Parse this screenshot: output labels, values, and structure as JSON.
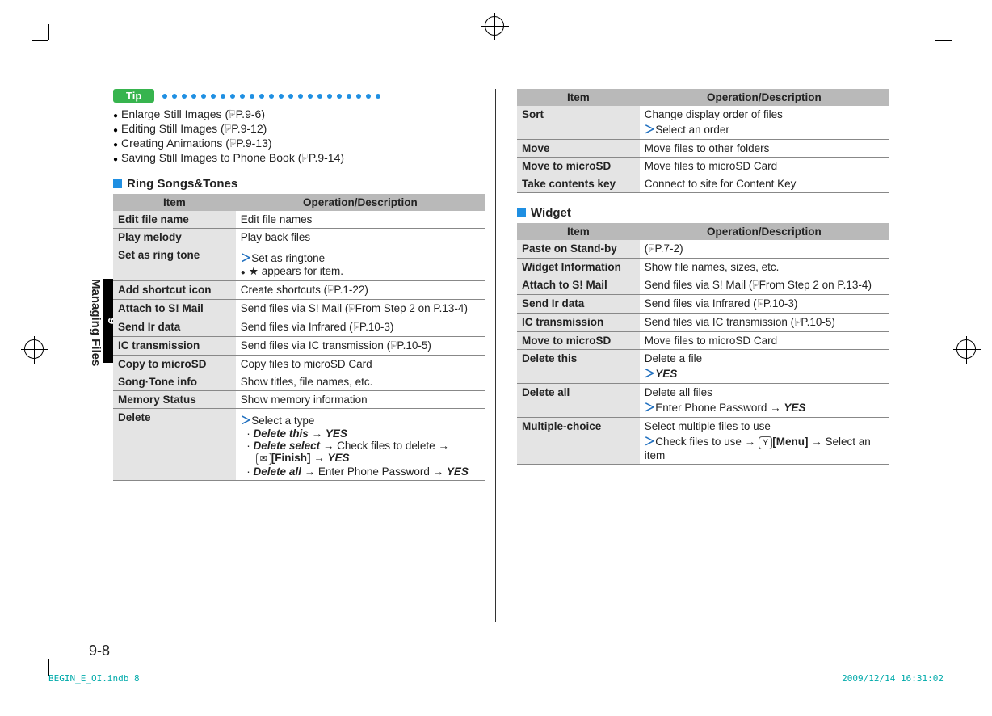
{
  "side": {
    "num": "9",
    "label": "Managing Files"
  },
  "tip": {
    "label": "Tip",
    "items": [
      {
        "text": "Enlarge Still Images (",
        "ref": "P.9-6",
        "tail": ")"
      },
      {
        "text": "Editing Still Images (",
        "ref": "P.9-12",
        "tail": ")"
      },
      {
        "text": "Creating Animations (",
        "ref": "P.9-13",
        "tail": ")"
      },
      {
        "text": "Saving Still Images to Phone Book (",
        "ref": "P.9-14",
        "tail": ")"
      }
    ]
  },
  "sect1": {
    "title": "Ring Songs&Tones",
    "headers": {
      "item": "Item",
      "op": "Operation/Description"
    },
    "rows": {
      "edit": {
        "item": "Edit file name",
        "op": "Edit file names"
      },
      "play": {
        "item": "Play melody",
        "op": "Play back files"
      },
      "ring": {
        "item": "Set as ring tone",
        "op1": "Set as ringtone",
        "op2": "★ appears for item."
      },
      "short": {
        "item": "Add shortcut icon",
        "op": "Create shortcuts (",
        "ref": "P.1-22",
        "tail": ")"
      },
      "attach": {
        "item": "Attach to S! Mail",
        "op": "Send files via S! Mail (",
        "ref": "From Step 2 on P.13-4",
        "tail": ")"
      },
      "ir": {
        "item": "Send Ir data",
        "op": "Send files via Infrared (",
        "ref": "P.10-3",
        "tail": ")"
      },
      "ic": {
        "item": "IC transmission",
        "op": "Send files via IC transmission (",
        "ref": "P.10-5",
        "tail": ")"
      },
      "copy": {
        "item": "Copy to microSD",
        "op": "Copy files to microSD Card"
      },
      "info": {
        "item": "Song·Tone info",
        "op": "Show titles, file names, etc."
      },
      "mem": {
        "item": "Memory Status",
        "op": "Show memory information"
      },
      "del": {
        "item": "Delete",
        "op1": "Select a type",
        "a1": "Delete this",
        "a1b": " → ",
        "a1c": "YES",
        "b1": "Delete select",
        "b1b": " → Check files to delete → ",
        "b1key": "✉",
        "b1keylbl": "[Finish]",
        "b1c": " → ",
        "b1d": "YES",
        "c1": "Delete all",
        "c1b": " → Enter Phone Password → ",
        "c1c": "YES"
      }
    }
  },
  "sect2": {
    "headers": {
      "item": "Item",
      "op": "Operation/Description"
    },
    "rows": {
      "sort": {
        "item": "Sort",
        "op1": "Change display order of files",
        "op2": "Select an order"
      },
      "move": {
        "item": "Move",
        "op": "Move files to other folders"
      },
      "movesd": {
        "item": "Move to microSD",
        "op": "Move files to microSD Card"
      },
      "take": {
        "item": "Take contents key",
        "op": "Connect to site for Content Key"
      }
    }
  },
  "sect3": {
    "title": "Widget",
    "headers": {
      "item": "Item",
      "op": "Operation/Description"
    },
    "rows": {
      "paste": {
        "item": "Paste on Stand-by",
        "op": "(",
        "ref": "P.7-2",
        "tail": ")"
      },
      "winfo": {
        "item": "Widget Information",
        "op": "Show file names, sizes, etc."
      },
      "attach": {
        "item": "Attach to S! Mail",
        "op": "Send files via S! Mail (",
        "ref": "From Step 2 on P.13-4",
        "tail": ")"
      },
      "ir": {
        "item": "Send Ir data",
        "op": "Send files via Infrared (",
        "ref": "P.10-3",
        "tail": ")"
      },
      "ic": {
        "item": "IC transmission",
        "op": "Send files via IC transmission (",
        "ref": "P.10-5",
        "tail": ")"
      },
      "movesd": {
        "item": "Move to microSD",
        "op": "Move files to microSD Card"
      },
      "delthis": {
        "item": "Delete this",
        "op1": "Delete a file",
        "op2": "YES"
      },
      "delall": {
        "item": "Delete all",
        "op1": "Delete all files",
        "op2": "Enter Phone Password → ",
        "op3": "YES"
      },
      "multi": {
        "item": "Multiple-choice",
        "op1": "Select multiple files to use",
        "op2": "Check files to use → ",
        "key": "Y",
        "keylbl": "[Menu]",
        "op3": " → Select an item"
      }
    }
  },
  "page_num": "9-8",
  "footer": {
    "left": "BEGIN_E_OI.indb   8",
    "right": "2009/12/14   16:31:02"
  }
}
